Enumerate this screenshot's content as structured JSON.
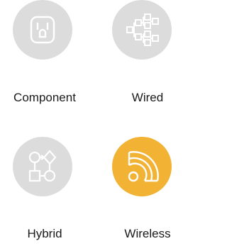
{
  "options": [
    {
      "label": "Component",
      "icon": "electrical-outlet-icon",
      "selected": false
    },
    {
      "label": "Wired",
      "icon": "wired-network-tree-icon",
      "selected": false
    },
    {
      "label": "Hybrid",
      "icon": "hybrid-flowchart-icon",
      "selected": false
    },
    {
      "label": "Wireless",
      "icon": "wireless-signal-icon",
      "selected": true
    }
  ],
  "colors": {
    "circle_default": "#dcdcdc",
    "circle_selected": "#f2b233",
    "icon_stroke": "#ffffff",
    "label_text": "#1a1a1a"
  }
}
